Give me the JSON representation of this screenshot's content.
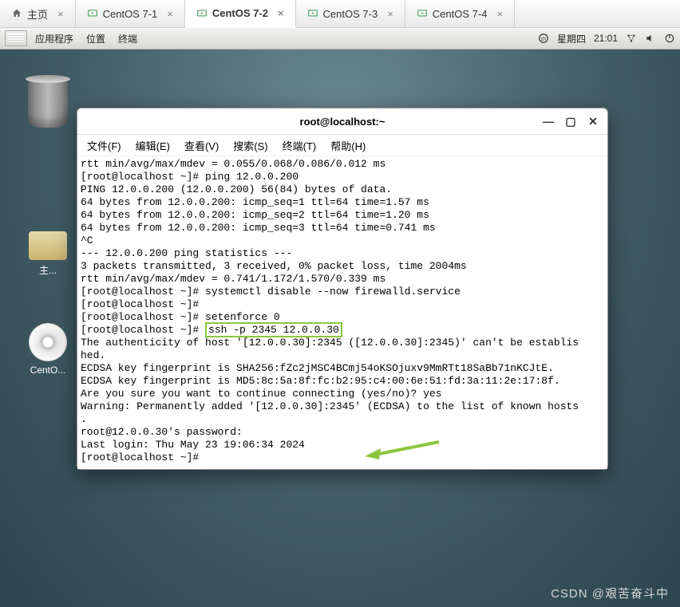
{
  "vm_tabs": {
    "home": "主页",
    "items": [
      {
        "label": "CentOS 7-1"
      },
      {
        "label": "CentOS 7-2",
        "active": true
      },
      {
        "label": "CentOS 7-3"
      },
      {
        "label": "CentOS 7-4"
      }
    ]
  },
  "panel": {
    "apps": "应用程序",
    "places": "位置",
    "terminal": "终端",
    "day": "星期四",
    "time": "21:01"
  },
  "desktop": {
    "home_folder": "主...",
    "cd_label": "CentO..."
  },
  "window": {
    "title": "root@localhost:~",
    "menu": {
      "file": "文件(F)",
      "edit": "编辑(E)",
      "view": "查看(V)",
      "search": "搜索(S)",
      "terminal_m": "终端(T)",
      "help": "帮助(H)"
    }
  },
  "term": {
    "l01": "rtt min/avg/max/mdev = 0.055/0.068/0.086/0.012 ms",
    "l02": "[root@localhost ~]# ping 12.0.0.200",
    "l03": "PING 12.0.0.200 (12.0.0.200) 56(84) bytes of data.",
    "l04": "64 bytes from 12.0.0.200: icmp_seq=1 ttl=64 time=1.57 ms",
    "l05": "64 bytes from 12.0.0.200: icmp_seq=2 ttl=64 time=1.20 ms",
    "l06": "64 bytes from 12.0.0.200: icmp_seq=3 ttl=64 time=0.741 ms",
    "l07": "^C",
    "l08": "--- 12.0.0.200 ping statistics ---",
    "l09": "3 packets transmitted, 3 received, 0% packet loss, time 2004ms",
    "l10": "rtt min/avg/max/mdev = 0.741/1.172/1.570/0.339 ms",
    "l11": "[root@localhost ~]# systemctl disable --now firewalld.service",
    "l12": "[root@localhost ~]# ",
    "l13": "[root@localhost ~]# setenforce 0",
    "l14a": "[root@localhost ~]# ",
    "l14b": "ssh -p 2345 12.0.0.30",
    "l15": "The authenticity of host '[12.0.0.30]:2345 ([12.0.0.30]:2345)' can't be establis",
    "l16": "hed.",
    "l17": "ECDSA key fingerprint is SHA256:fZc2jMSC4BCmj54oKSOjuxv9MmRTt18SaBb71nKCJtE.",
    "l18": "ECDSA key fingerprint is MD5:8c:5a:8f:fc:b2:95:c4:00:6e:51:fd:3a:11:2e:17:8f.",
    "l19": "Are you sure you want to continue connecting (yes/no)? yes",
    "l20": "Warning: Permanently added '[12.0.0.30]:2345' (ECDSA) to the list of known hosts",
    "l21": ".",
    "l22": "root@12.0.0.30's password:",
    "l23": "Last login: Thu May 23 19:06:34 2024",
    "l24": "[root@localhost ~]# "
  },
  "watermark": "CSDN @艰苦奋斗中"
}
